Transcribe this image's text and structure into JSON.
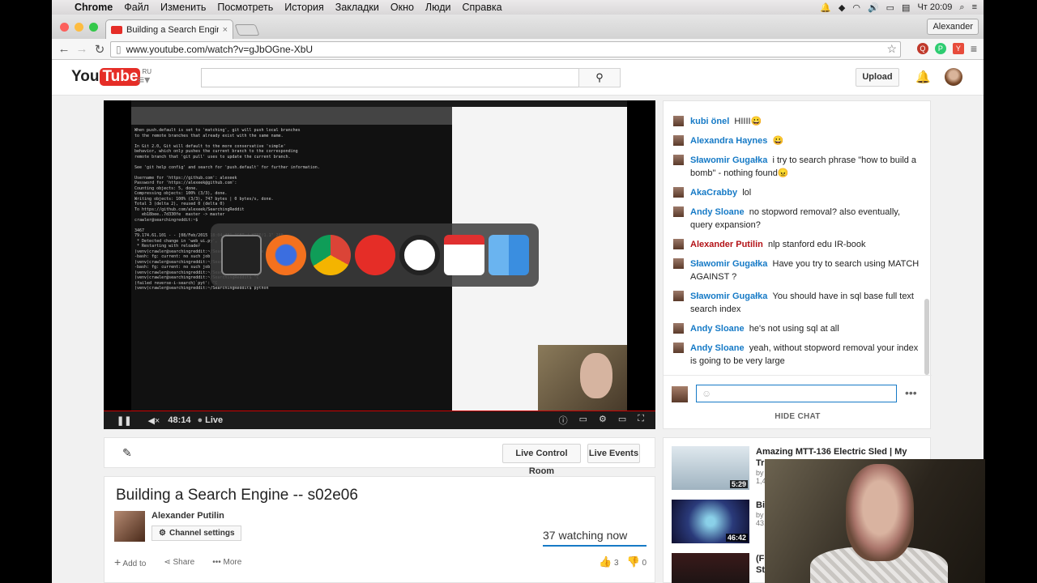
{
  "mac_menu": {
    "app": "Chrome",
    "items": [
      "Файл",
      "Изменить",
      "Посмотреть",
      "История",
      "Закладки",
      "Окно",
      "Люди",
      "Справка"
    ],
    "clock": "Чт 20:09"
  },
  "browser": {
    "tab_title": "Building a Search Engine",
    "profile": "Alexander",
    "url": "www.youtube.com/watch?v=gJbOGne-XbU"
  },
  "youtube": {
    "logo_you": "You",
    "logo_tube": "Tube",
    "region": "RU",
    "upload_label": "Upload"
  },
  "player": {
    "time": "48:14",
    "live": "Live",
    "dock_label": "Firefox"
  },
  "chat": {
    "messages": [
      {
        "author": "kubi önel",
        "text": "HIIII😀",
        "owner": false
      },
      {
        "author": "Alexandra Haynes",
        "text": "😀",
        "owner": false
      },
      {
        "author": "Sławomir Gugałka",
        "text": "i try to search phrase \"how to build a bomb\" - nothing found😠",
        "owner": false
      },
      {
        "author": "AkaCrabby",
        "text": "lol",
        "owner": false
      },
      {
        "author": "Andy Sloane",
        "text": "no stopword removal? also eventually, query expansion?",
        "owner": false
      },
      {
        "author": "Alexander Putilin",
        "text": "nlp stanford edu IR-book",
        "owner": true
      },
      {
        "author": "Sławomir Gugałka",
        "text": "Have you try to search using MATCH AGAINST ?",
        "owner": false
      },
      {
        "author": "Sławomir Gugałka",
        "text": "You should have in sql base full text search index",
        "owner": false
      },
      {
        "author": "Andy Sloane",
        "text": "he's not using sql at all",
        "owner": false
      },
      {
        "author": "Andy Sloane",
        "text": "yeah, without stopword removal your index is going to be very large",
        "owner": false
      }
    ],
    "hide_label": "HIDE CHAT"
  },
  "editbar": {
    "live_control_room": "Live Control Room",
    "live_events": "Live Events"
  },
  "video": {
    "title": "Building a Search Engine -- s02e06",
    "channel": "Alexander Putilin",
    "channel_settings": "Channel settings",
    "watching": "37 watching now",
    "add_to": "Add to",
    "share": "Share",
    "more": "More",
    "likes": "3",
    "dislikes": "0"
  },
  "related": [
    {
      "title": "Amazing MTT-136 Electric Sled | My",
      "title2": "Tr",
      "meta": "by",
      "meta2": "1,4",
      "duration": "5:29"
    },
    {
      "title": "Bi",
      "title2": "",
      "meta": "by",
      "meta2": "43,",
      "duration": "46:42"
    },
    {
      "title": "(F",
      "title2": "St",
      "meta": "",
      "meta2": "",
      "duration": ""
    }
  ],
  "colors": {
    "youtube_red": "#e52d27",
    "link_blue": "#167ac6",
    "owner_red": "#b31217"
  }
}
